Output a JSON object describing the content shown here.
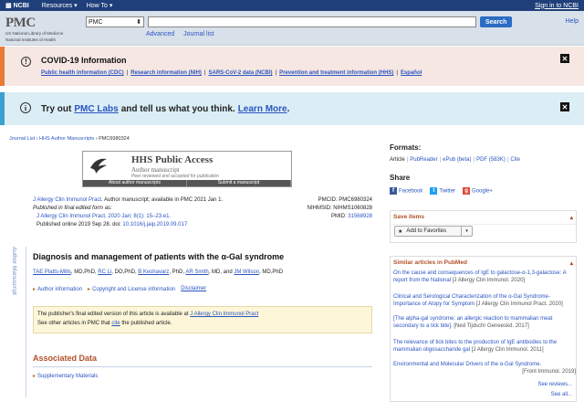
{
  "topbar": {
    "brand": "NCBI",
    "resources": "Resources",
    "howto": "How To",
    "signin": "Sign in to NCBI"
  },
  "logo": {
    "name": "PMC",
    "line1": "US National Library of Medicine",
    "line2": "National Institutes of Health"
  },
  "search": {
    "db_value": "PMC",
    "button": "Search",
    "advanced": "Advanced",
    "journal_list": "Journal list",
    "help": "Help"
  },
  "covid": {
    "title": "COVID-19 Information",
    "links": [
      "Public health information (CDC)",
      "Research information (NIH)",
      "SARS-CoV-2 data (NCBI)",
      "Prevention and treatment information (HHS)",
      "Español"
    ],
    "separator": "|"
  },
  "pmclabs": {
    "pre": "Try out",
    "link": "PMC Labs",
    "mid": "and tell us what you think.",
    "learn": "Learn More",
    "post": "."
  },
  "breadcrumb": {
    "journal_list": "Journal List",
    "sep": " › ",
    "hhs": "HHS Author Manuscripts",
    "id": "PMC6980324"
  },
  "hhs_banner": {
    "title": "HHS Public Access",
    "subtitle": "Author manuscript",
    "note": "Peer reviewed and accepted for publication",
    "btn_about": "About author manuscripts",
    "btn_submit": "Submit a manuscript"
  },
  "citation": {
    "journal": "J Allergy Clin Immunol Pract",
    "avail": ". Author manuscript; available in PMC 2021 Jan 1.",
    "published_final": "Published in final edited form as:",
    "final_ref": "J Allergy Clin Immunol Pract. 2020 Jan; 8(1): 15–23.e1.",
    "online": "Published online 2019 Sep 28. doi:",
    "doi": "10.1016/j.jaip.2019.09.017",
    "pmcid_label": "PMCID:",
    "pmcid": "PMC6980324",
    "nihmsid_label": "NIHMSID:",
    "nihmsid": "NIHMS1060828",
    "pmid_label": "PMID:",
    "pmid": "31568928"
  },
  "vertical_label": "Author Manuscript",
  "article": {
    "title": "Diagnosis and management of patients with the α-Gal syndrome",
    "authors": [
      {
        "name": "TAE Platts-Mills",
        "suffix": ", MD,PhD, "
      },
      {
        "name": "RC Li",
        "suffix": ", DO,PhD, "
      },
      {
        "name": "B Keshavarz",
        "suffix": ", PhD, "
      },
      {
        "name": "AR Smith",
        "suffix": ", MD, and "
      },
      {
        "name": "JM Wilson",
        "suffix": ", MD,PhD"
      }
    ],
    "author_info": "Author information",
    "copyright": "Copyright and License information",
    "disclaimer": "Disclaimer"
  },
  "notice": {
    "line1": "The publisher's final edited version of this article is available at",
    "link1": "J Allergy Clin Immunol Pract",
    "line2a": "See other articles in PMC that",
    "cite": "cite",
    "line2b": "the published article."
  },
  "associated": {
    "title": "Associated Data",
    "supp": "Supplementary Materials"
  },
  "sidebar": {
    "formats_h": "Formats:",
    "formats": [
      "Article",
      "PubReader",
      "ePub (beta)",
      "PDF (583K)",
      "Cite"
    ],
    "share_h": "Share",
    "share": [
      "Facebook",
      "Twitter",
      "Google+"
    ],
    "save_h": "Save items",
    "add_fav": "Add to Favorites",
    "similar_h": "Similar articles in PubMed",
    "similar": [
      {
        "title": "On the cause and consequences of IgE to galactose-α-1,3-galactose: A report from the National",
        "src": "[J Allergy Clin Immunol. 2020]"
      },
      {
        "title": "Clinical and Serological Characterization of the α-Gal Syndrome-Importance of Atopy for Symptom",
        "src": "[J Allergy Clin Immunol Pract. 2020]"
      },
      {
        "title": "[The alpha-gal syndrome: an allergic reaction to mammalian meat secondary to a tick bite].",
        "src": "[Ned Tijdschr Geneeskd. 2017]"
      },
      {
        "title": "The relevance of tick bites to the production of IgE antibodies to the mammalian oligosaccharide gal",
        "src": "[J Allergy Clin Immunol. 2011]"
      },
      {
        "title": "Environmental and Molecular Drivers of the α-Gal Syndrome.",
        "src": "[Front Immunol. 2019]"
      }
    ],
    "see_reviews": "See reviews...",
    "see_all": "See all..."
  },
  "colors": {
    "topbar": "#1f3f7a",
    "covid_accent": "#e87c34",
    "labs_accent": "#3aa0cf",
    "heading_accent": "#b2502a",
    "link": "#2a55c0"
  }
}
